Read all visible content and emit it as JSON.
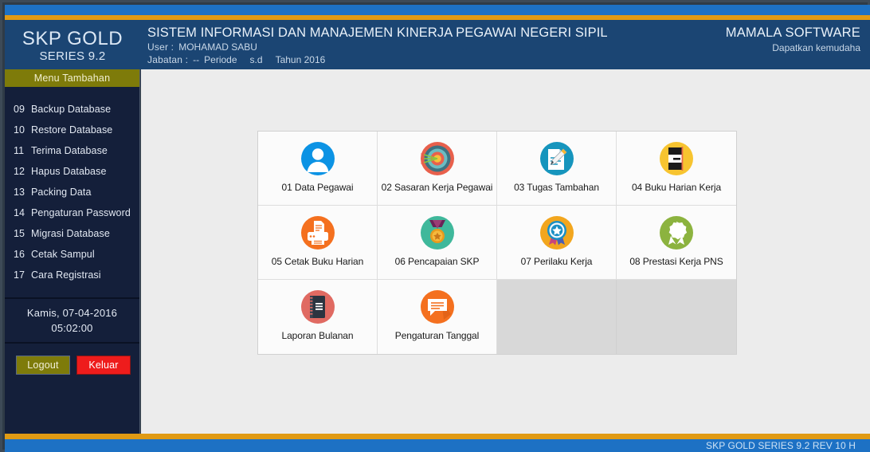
{
  "window": {
    "accent_gold": "#e09a14",
    "accent_blue": "#1d71c4",
    "header_blue": "#1b4573",
    "sidebar_navy": "#141f3a",
    "olive": "#7e7b0a",
    "red": "#ee1c1c"
  },
  "header": {
    "brand_title": "SKP GOLD",
    "brand_sub": "SERIES 9.2",
    "system_title": "SISTEM INFORMASI DAN MANAJEMEN KINERJA PEGAWAI NEGERI SIPIL",
    "user_label": "User :",
    "user_value": "MOHAMAD SABU",
    "jabatan_label": "Jabatan :",
    "jabatan_value": "--",
    "periode_label": "Periode",
    "periode_sd": "s.d",
    "tahun_value": "Tahun 2016",
    "corp_title": "MAMALA SOFTWARE",
    "corp_sub": "Dapatkan kemudaha"
  },
  "sidebar": {
    "menu_header": "Menu Tambahan",
    "items": [
      {
        "num": "09",
        "label": "Backup Database"
      },
      {
        "num": "10",
        "label": "Restore Database"
      },
      {
        "num": "11",
        "label": "Terima Database"
      },
      {
        "num": "12",
        "label": "Hapus Database"
      },
      {
        "num": "13",
        "label": "Packing Data"
      },
      {
        "num": "14",
        "label": "Pengaturan Password"
      },
      {
        "num": "15",
        "label": "Migrasi Database"
      },
      {
        "num": "16",
        "label": "Cetak Sampul"
      },
      {
        "num": "17",
        "label": "Cara Registrasi"
      }
    ],
    "clock": {
      "date": "Kamis,  07-04-2016",
      "time": "05:02:00"
    },
    "logout_label": "Logout",
    "keluar_label": "Keluar"
  },
  "main": {
    "tiles": [
      {
        "label": "01 Data Pegawai",
        "icon": "user-avatar-icon",
        "empty": false
      },
      {
        "label": "02 Sasaran Kerja Pegawai",
        "icon": "target-arrows-icon",
        "empty": false
      },
      {
        "label": "03 Tugas Tambahan",
        "icon": "document-pencil-icon",
        "empty": false
      },
      {
        "label": "04 Buku Harian Kerja",
        "icon": "notebook-icon",
        "empty": false
      },
      {
        "label": "05 Cetak Buku Harian",
        "icon": "printer-icon",
        "empty": false
      },
      {
        "label": "06 Pencapaian SKP",
        "icon": "medal-icon",
        "empty": false
      },
      {
        "label": "07 Perilaku Kerja",
        "icon": "award-ribbon-icon",
        "empty": false
      },
      {
        "label": "08 Prestasi Kerja PNS",
        "icon": "rosette-icon",
        "empty": false
      },
      {
        "label": "Laporan Bulanan",
        "icon": "ledger-book-icon",
        "empty": false
      },
      {
        "label": "Pengaturan Tanggal",
        "icon": "message-lines-icon",
        "empty": false
      },
      {
        "label": "",
        "icon": "",
        "empty": true
      },
      {
        "label": "",
        "icon": "",
        "empty": true
      }
    ]
  },
  "statusbar": {
    "text": "SKP GOLD SERIES 9.2  REV 10 H"
  }
}
